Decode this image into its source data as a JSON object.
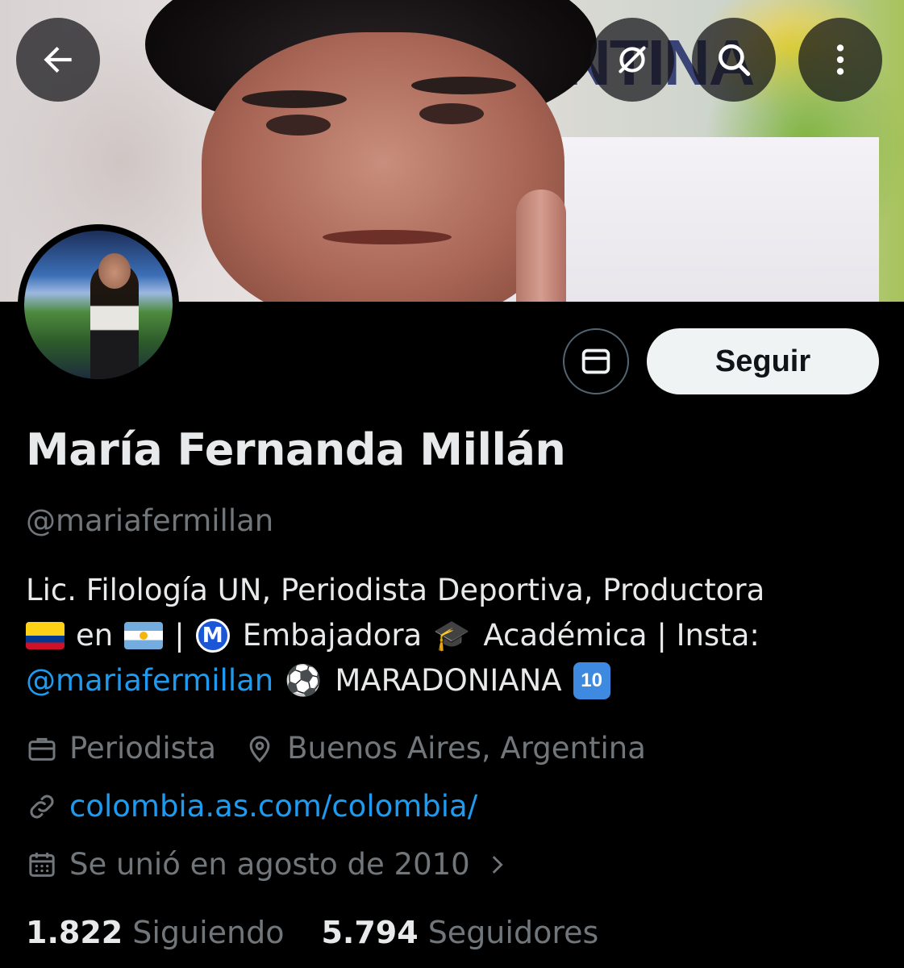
{
  "header": {
    "back_icon": "arrow-left-icon",
    "grok_icon": "slash-circle-icon",
    "search_icon": "search-icon",
    "more_icon": "more-vertical-icon"
  },
  "profile": {
    "name": "María Fernanda Millán",
    "handle": "@mariafermillan",
    "follow_label": "Seguir",
    "message_icon": "envelope-icon",
    "bio": {
      "line1": "Lic. Filología UN, Periodista Deportiva, Productora",
      "line2_en": "en",
      "line2_sep": "|",
      "line2_embajadora": "Embajadora",
      "line2_rest": "Académica | Insta:",
      "line3_mention": "@mariafermillan",
      "line3_text": "MARADONIANA",
      "badge_m": "M",
      "badge_ten": "10",
      "emoji_cap": "🎓",
      "emoji_ball": "⚽"
    },
    "profession": "Periodista",
    "location": "Buenos Aires, Argentina",
    "website": "colombia.as.com/colombia/",
    "joined": "Se unió en agosto de 2010",
    "following_count": "1.822",
    "following_label": "Siguiendo",
    "followers_count": "5.794",
    "followers_label": "Seguidores"
  },
  "colors": {
    "link": "#1d9bf0",
    "muted": "#71767b",
    "text": "#e7e9ea",
    "background": "#000000"
  }
}
